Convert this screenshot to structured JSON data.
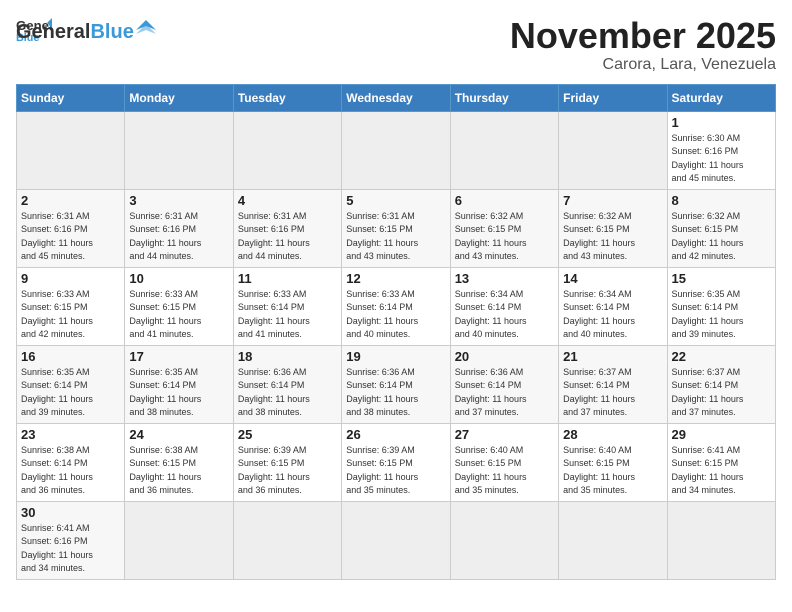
{
  "header": {
    "logo_line1": "General",
    "logo_line2": "Blue",
    "month_title": "November 2025",
    "location": "Carora, Lara, Venezuela"
  },
  "weekdays": [
    "Sunday",
    "Monday",
    "Tuesday",
    "Wednesday",
    "Thursday",
    "Friday",
    "Saturday"
  ],
  "weeks": [
    [
      {
        "day": "",
        "info": ""
      },
      {
        "day": "",
        "info": ""
      },
      {
        "day": "",
        "info": ""
      },
      {
        "day": "",
        "info": ""
      },
      {
        "day": "",
        "info": ""
      },
      {
        "day": "",
        "info": ""
      },
      {
        "day": "1",
        "info": "Sunrise: 6:30 AM\nSunset: 6:16 PM\nDaylight: 11 hours\nand 45 minutes."
      }
    ],
    [
      {
        "day": "2",
        "info": "Sunrise: 6:31 AM\nSunset: 6:16 PM\nDaylight: 11 hours\nand 45 minutes."
      },
      {
        "day": "3",
        "info": "Sunrise: 6:31 AM\nSunset: 6:16 PM\nDaylight: 11 hours\nand 44 minutes."
      },
      {
        "day": "4",
        "info": "Sunrise: 6:31 AM\nSunset: 6:16 PM\nDaylight: 11 hours\nand 44 minutes."
      },
      {
        "day": "5",
        "info": "Sunrise: 6:31 AM\nSunset: 6:15 PM\nDaylight: 11 hours\nand 43 minutes."
      },
      {
        "day": "6",
        "info": "Sunrise: 6:32 AM\nSunset: 6:15 PM\nDaylight: 11 hours\nand 43 minutes."
      },
      {
        "day": "7",
        "info": "Sunrise: 6:32 AM\nSunset: 6:15 PM\nDaylight: 11 hours\nand 43 minutes."
      },
      {
        "day": "8",
        "info": "Sunrise: 6:32 AM\nSunset: 6:15 PM\nDaylight: 11 hours\nand 42 minutes."
      }
    ],
    [
      {
        "day": "9",
        "info": "Sunrise: 6:33 AM\nSunset: 6:15 PM\nDaylight: 11 hours\nand 42 minutes."
      },
      {
        "day": "10",
        "info": "Sunrise: 6:33 AM\nSunset: 6:15 PM\nDaylight: 11 hours\nand 41 minutes."
      },
      {
        "day": "11",
        "info": "Sunrise: 6:33 AM\nSunset: 6:14 PM\nDaylight: 11 hours\nand 41 minutes."
      },
      {
        "day": "12",
        "info": "Sunrise: 6:33 AM\nSunset: 6:14 PM\nDaylight: 11 hours\nand 40 minutes."
      },
      {
        "day": "13",
        "info": "Sunrise: 6:34 AM\nSunset: 6:14 PM\nDaylight: 11 hours\nand 40 minutes."
      },
      {
        "day": "14",
        "info": "Sunrise: 6:34 AM\nSunset: 6:14 PM\nDaylight: 11 hours\nand 40 minutes."
      },
      {
        "day": "15",
        "info": "Sunrise: 6:35 AM\nSunset: 6:14 PM\nDaylight: 11 hours\nand 39 minutes."
      }
    ],
    [
      {
        "day": "16",
        "info": "Sunrise: 6:35 AM\nSunset: 6:14 PM\nDaylight: 11 hours\nand 39 minutes."
      },
      {
        "day": "17",
        "info": "Sunrise: 6:35 AM\nSunset: 6:14 PM\nDaylight: 11 hours\nand 38 minutes."
      },
      {
        "day": "18",
        "info": "Sunrise: 6:36 AM\nSunset: 6:14 PM\nDaylight: 11 hours\nand 38 minutes."
      },
      {
        "day": "19",
        "info": "Sunrise: 6:36 AM\nSunset: 6:14 PM\nDaylight: 11 hours\nand 38 minutes."
      },
      {
        "day": "20",
        "info": "Sunrise: 6:36 AM\nSunset: 6:14 PM\nDaylight: 11 hours\nand 37 minutes."
      },
      {
        "day": "21",
        "info": "Sunrise: 6:37 AM\nSunset: 6:14 PM\nDaylight: 11 hours\nand 37 minutes."
      },
      {
        "day": "22",
        "info": "Sunrise: 6:37 AM\nSunset: 6:14 PM\nDaylight: 11 hours\nand 37 minutes."
      }
    ],
    [
      {
        "day": "23",
        "info": "Sunrise: 6:38 AM\nSunset: 6:14 PM\nDaylight: 11 hours\nand 36 minutes."
      },
      {
        "day": "24",
        "info": "Sunrise: 6:38 AM\nSunset: 6:15 PM\nDaylight: 11 hours\nand 36 minutes."
      },
      {
        "day": "25",
        "info": "Sunrise: 6:39 AM\nSunset: 6:15 PM\nDaylight: 11 hours\nand 36 minutes."
      },
      {
        "day": "26",
        "info": "Sunrise: 6:39 AM\nSunset: 6:15 PM\nDaylight: 11 hours\nand 35 minutes."
      },
      {
        "day": "27",
        "info": "Sunrise: 6:40 AM\nSunset: 6:15 PM\nDaylight: 11 hours\nand 35 minutes."
      },
      {
        "day": "28",
        "info": "Sunrise: 6:40 AM\nSunset: 6:15 PM\nDaylight: 11 hours\nand 35 minutes."
      },
      {
        "day": "29",
        "info": "Sunrise: 6:41 AM\nSunset: 6:15 PM\nDaylight: 11 hours\nand 34 minutes."
      }
    ],
    [
      {
        "day": "30",
        "info": "Sunrise: 6:41 AM\nSunset: 6:16 PM\nDaylight: 11 hours\nand 34 minutes."
      },
      {
        "day": "",
        "info": ""
      },
      {
        "day": "",
        "info": ""
      },
      {
        "day": "",
        "info": ""
      },
      {
        "day": "",
        "info": ""
      },
      {
        "day": "",
        "info": ""
      },
      {
        "day": "",
        "info": ""
      }
    ]
  ]
}
